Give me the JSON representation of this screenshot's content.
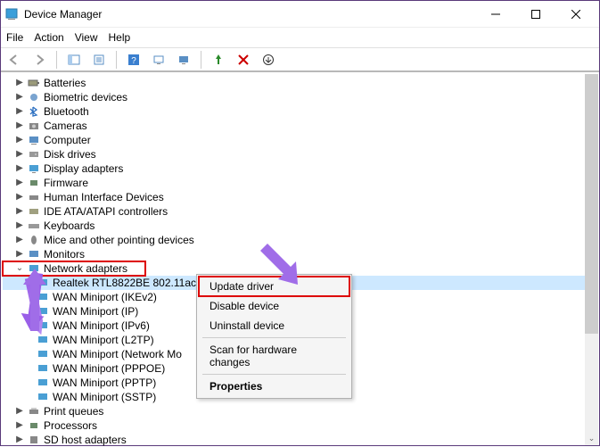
{
  "title": "Device Manager",
  "menus": [
    "File",
    "Action",
    "View",
    "Help"
  ],
  "tree": {
    "categories": [
      {
        "label": "Batteries",
        "icon": "battery"
      },
      {
        "label": "Biometric devices",
        "icon": "fingerprint"
      },
      {
        "label": "Bluetooth",
        "icon": "bluetooth"
      },
      {
        "label": "Cameras",
        "icon": "camera"
      },
      {
        "label": "Computer",
        "icon": "computer"
      },
      {
        "label": "Disk drives",
        "icon": "disk"
      },
      {
        "label": "Display adapters",
        "icon": "display"
      },
      {
        "label": "Firmware",
        "icon": "chip"
      },
      {
        "label": "Human Interface Devices",
        "icon": "hid"
      },
      {
        "label": "IDE ATA/ATAPI controllers",
        "icon": "ide"
      },
      {
        "label": "Keyboards",
        "icon": "keyboard"
      },
      {
        "label": "Mice and other pointing devices",
        "icon": "mouse"
      },
      {
        "label": "Monitors",
        "icon": "monitor"
      }
    ],
    "network": {
      "label": "Network adapters",
      "children": [
        "Realtek RTL8822BE 802.11ac PCIe Adapter",
        "WAN Miniport (IKEv2)",
        "WAN Miniport (IP)",
        "WAN Miniport (IPv6)",
        "WAN Miniport (L2TP)",
        "WAN Miniport (Network Mo",
        "WAN Miniport (PPPOE)",
        "WAN Miniport (PPTP)",
        "WAN Miniport (SSTP)"
      ]
    },
    "after": [
      {
        "label": "Print queues",
        "icon": "printer"
      },
      {
        "label": "Processors",
        "icon": "cpu"
      },
      {
        "label": "SD host adapters",
        "icon": "sd"
      }
    ]
  },
  "context": {
    "update": "Update driver",
    "disable": "Disable device",
    "uninstall": "Uninstall device",
    "scan": "Scan for hardware changes",
    "props": "Properties"
  }
}
